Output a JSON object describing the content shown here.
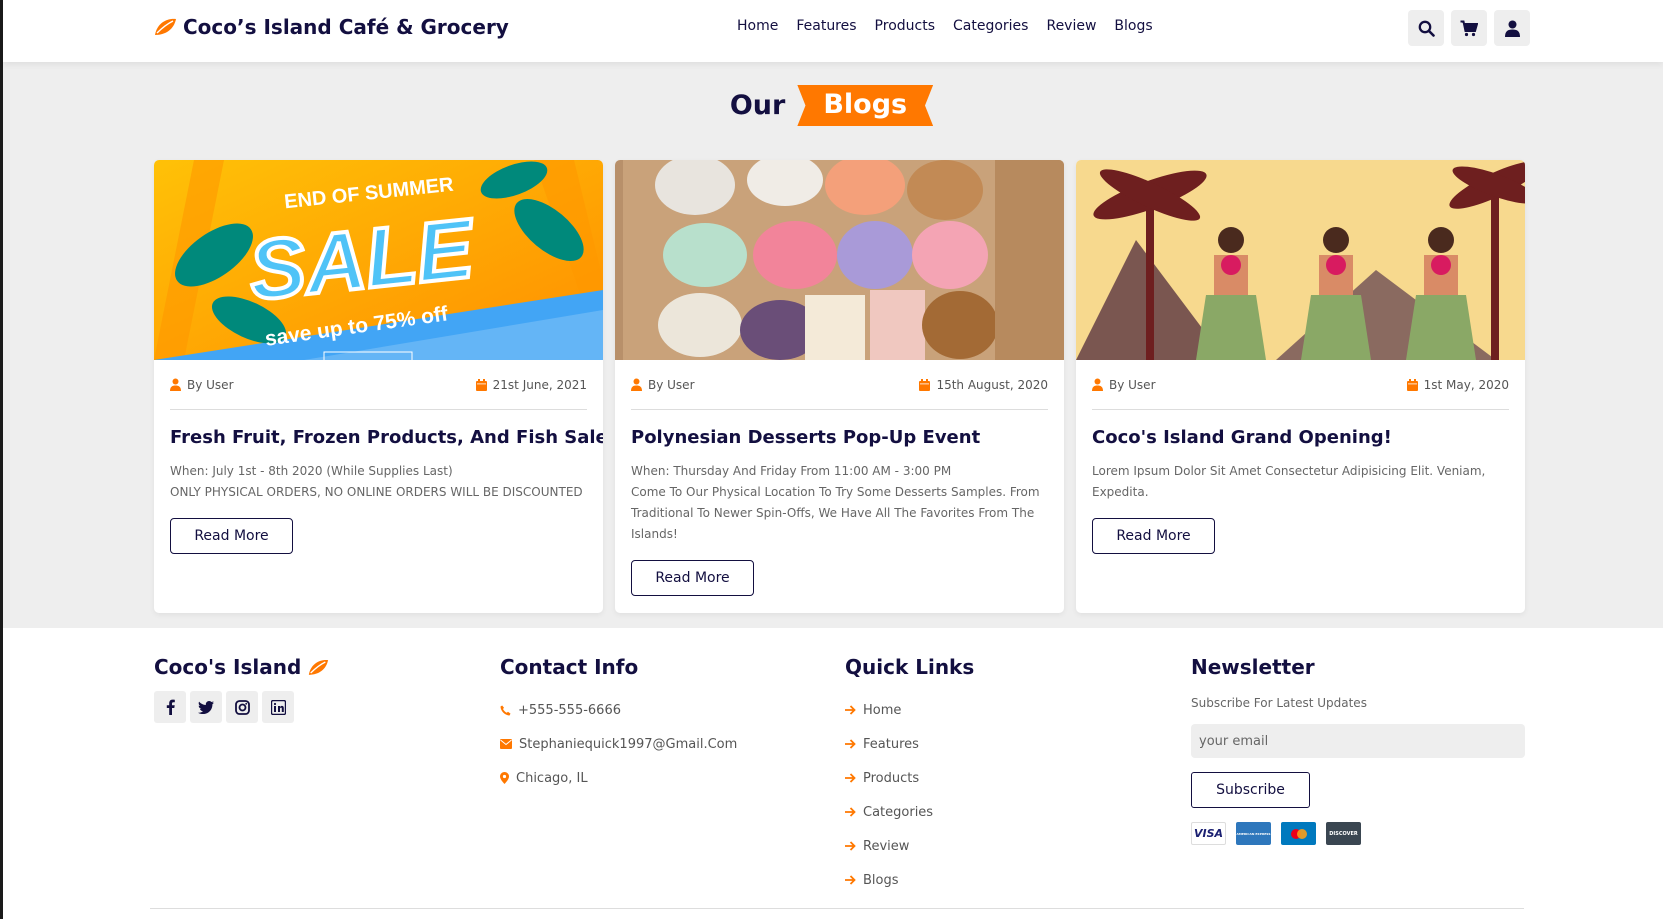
{
  "header": {
    "brand": "Coco’s Island Café & Grocery",
    "nav": [
      "Home",
      "Features",
      "Products",
      "Categories",
      "Review",
      "Blogs"
    ],
    "icons": [
      "search-icon",
      "cart-icon",
      "user-icon"
    ]
  },
  "section": {
    "title_plain": "Our",
    "title_tag": "Blogs"
  },
  "blogs": [
    {
      "author": "By User",
      "date": "21st June, 2021",
      "title": "Fresh Fruit, Frozen Products, And Fish Sale",
      "lines": [
        "When: July 1st - 8th 2020 (While Supplies Last)",
        "ONLY PHYSICAL ORDERS, NO ONLINE ORDERS WILL BE DISCOUNTED"
      ],
      "button": "Read More",
      "image": {
        "line1": "END OF SUMMER",
        "line2": "SALE",
        "line3": "save up to 75% off"
      }
    },
    {
      "author": "By User",
      "date": "15th August, 2020",
      "title": "Polynesian Desserts Pop-Up Event",
      "lines": [
        "When: Thursday And Friday From 11:00 AM - 3:00 PM",
        "Come To Our Physical Location To Try Some Desserts Samples. From Traditional To Newer Spin-Offs, We Have All The Favorites From The Islands!"
      ],
      "button": "Read More"
    },
    {
      "author": "By User",
      "date": "1st May, 2020",
      "title": "Coco's Island Grand Opening!",
      "lines": [
        "Lorem Ipsum Dolor Sit Amet Consectetur Adipisicing Elit. Veniam, Expedita."
      ],
      "button": "Read More"
    }
  ],
  "footer": {
    "brand": "Coco's Island",
    "social": [
      "facebook-icon",
      "twitter-icon",
      "instagram-icon",
      "linkedin-icon"
    ],
    "contact_title": "Contact Info",
    "phone": "+555-555-6666",
    "email": "Stephaniequick1997@Gmail.Com",
    "location": "Chicago, IL",
    "links_title": "Quick Links",
    "links": [
      "Home",
      "Features",
      "Products",
      "Categories",
      "Review",
      "Blogs"
    ],
    "newsletter_title": "Newsletter",
    "newsletter_text": "Subscribe For Latest Updates",
    "email_placeholder": "your email",
    "subscribe": "Subscribe",
    "payments": [
      "VISA",
      "AMERICAN EXPRESS",
      "MASTERCARD",
      "DISCOVER"
    ]
  },
  "colors": {
    "accent": "#ff7800",
    "dark": "#130f40",
    "bg": "#eeeeee"
  }
}
